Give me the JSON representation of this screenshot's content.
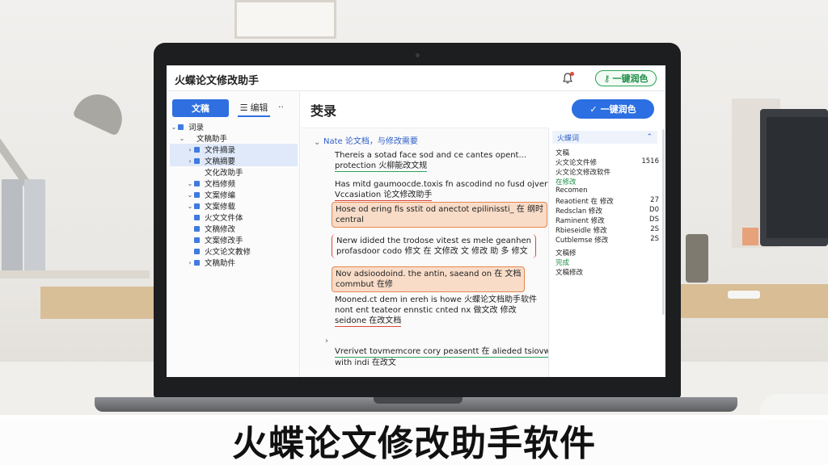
{
  "app": {
    "title": "火蝶论文修改助手"
  },
  "topbar": {
    "bell_icon": "bell-icon",
    "polish_button": "一键润色"
  },
  "left_panel": {
    "tab_document": "文稿",
    "tab_edit": "编辑",
    "tab_more": "··",
    "tree": [
      {
        "label": "词录",
        "caret": "v",
        "icon": true,
        "selected": false
      },
      {
        "label": "文稿助手",
        "caret": "v",
        "icon": false,
        "selected": false
      },
      {
        "label": "文件摘录",
        "caret": ">",
        "icon": true,
        "selected": true
      },
      {
        "label": "文稿摘要",
        "caret": ">",
        "icon": true,
        "selected": true
      },
      {
        "label": "文化改助手",
        "caret": "",
        "icon": false,
        "selected": false
      },
      {
        "label": "文档修频",
        "caret": "v",
        "icon": true,
        "selected": false
      },
      {
        "label": "文案修编",
        "caret": "v",
        "icon": true,
        "selected": false
      },
      {
        "label": "文案修载",
        "caret": "v",
        "icon": true,
        "selected": false
      },
      {
        "label": "火文文件体",
        "caret": "",
        "icon": true,
        "selected": false
      },
      {
        "label": "文稿修改",
        "caret": "",
        "icon": true,
        "selected": false
      },
      {
        "label": "文案修改手",
        "caret": "",
        "icon": true,
        "selected": false
      },
      {
        "label": "火文论文教修",
        "caret": "",
        "icon": true,
        "selected": false
      },
      {
        "label": "文稿助件",
        "caret": ">",
        "icon": true,
        "selected": false
      }
    ]
  },
  "main": {
    "title": "茭录",
    "primary_button": "一键润色",
    "paragraphs": [
      {
        "line1": "Nate 论文档，与修改需要",
        "line2": ""
      },
      {
        "line1": "Thereis a sotad face sod and ce cantes opent...",
        "line2": "protection 火柳能改文规"
      },
      {
        "line1": "Has mitd gaumoocde.toxis fn ascodind no fusd ojvert...",
        "line2": "Vccasiation 论文修改助手"
      },
      {
        "line1": "Hose od ering fis sstit od anectot epilinissti_ 在 纲时",
        "line2": "central"
      },
      {
        "line1": "Nerw idided the trodose vitest es mele geanhen",
        "line2": "profasdoor codo 修文 在 文修改 文 修改 助 多 修文"
      },
      {
        "line1": "Nov adsioodoind. the antin, saeand on 在 文档",
        "line2": "commbut 在修"
      },
      {
        "line1": "Mooned.ct dem in ereh is howe 火蝶论文档助手软件",
        "line2": "nont ent teateor ennstic cnted nx 做文改 修改"
      },
      {
        "line3": "seidone 在改文档"
      },
      {
        "line1": "Vrerivet tovmemcore cory peasentt 在 alieded tsiovw",
        "line2": "with indi 在改文"
      }
    ]
  },
  "right_panel": {
    "header": "火蝶词",
    "rows": [
      {
        "label": "文稿",
        "value": "",
        "green": false,
        "gap": false
      },
      {
        "label": "火文论文件修",
        "value": "1516",
        "green": false,
        "gap": false
      },
      {
        "label": "火文论文修改软件",
        "value": "",
        "green": false,
        "gap": false
      },
      {
        "label": "在修改",
        "value": "",
        "green": true,
        "gap": false
      },
      {
        "label": "Recomen",
        "value": "",
        "green": false,
        "gap": false
      },
      {
        "label": "Reaotient 在 修改",
        "value": "27",
        "green": false,
        "gap": false
      },
      {
        "label": "Redsclan 修改",
        "value": "D0",
        "green": false,
        "gap": false
      },
      {
        "label": "Raminent 修改",
        "value": "DS",
        "green": false,
        "gap": false
      },
      {
        "label": "Rbieseidle 修改",
        "value": "2S",
        "green": false,
        "gap": false
      },
      {
        "label": "Cutblemse 修改",
        "value": "2S",
        "green": false,
        "gap": false
      },
      {
        "label": "文稿修",
        "value": "",
        "green": false,
        "gap": true
      },
      {
        "label": "完成",
        "value": "",
        "green": true,
        "gap": false
      },
      {
        "label": "文稿修改",
        "value": "",
        "green": false,
        "gap": false
      }
    ]
  },
  "caption": "火蝶论文修改助手软件",
  "colors": {
    "accent_blue": "#2b6fe2",
    "accent_green": "#27a254",
    "highlight_orange": "#e8864f"
  }
}
